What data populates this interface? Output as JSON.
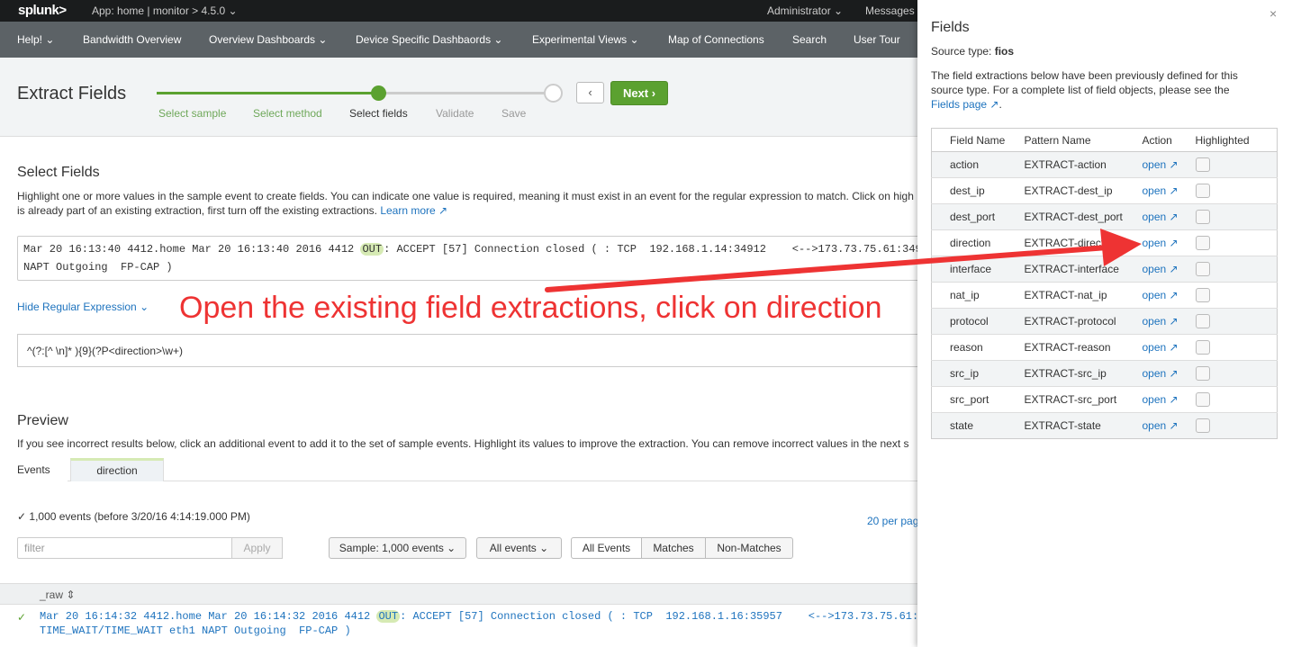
{
  "topbar": {
    "logo": "splunk>",
    "app": "App: home | monitor > 4.5.0 ⌄",
    "admin": "Administrator ⌄",
    "messages": "Messages"
  },
  "nav": {
    "items": [
      "Help! ⌄",
      "Bandwidth Overview",
      "Overview Dashboards ⌄",
      "Device Specific Dashbaords ⌄",
      "Experimental Views ⌄",
      "Map of Connections",
      "Search",
      "User Tour"
    ]
  },
  "header": {
    "title": "Extract Fields",
    "steps": [
      "Select sample",
      "Select method",
      "Select fields",
      "Validate",
      "Save"
    ],
    "back_label": "‹",
    "next_label": "Next ›"
  },
  "select_fields": {
    "title": "Select Fields",
    "desc_line1": "Highlight one or more values in the sample event to create fields. You can indicate one value is required, meaning it must exist in an event for the regular expression to match. Click on high",
    "desc_line2": "is already part of an existing extraction, first turn off the existing extractions.",
    "learn_more": "Learn more ↗",
    "sample_pre": "Mar 20 16:13:40 4412.home Mar 20 16:13:40 2016 4412 ",
    "sample_hl": "OUT",
    "sample_post": ": ACCEPT [57] Connection closed ( : TCP  192.168.1.14:34912    <-->173.73.75.61:349",
    "sample_line2": "NAPT Outgoing  FP-CAP )",
    "hide_regex": "Hide Regular Expression ⌄",
    "regex": "^(?:[^ \\n]* ){9}(?P<direction>\\w+)"
  },
  "annotation": "Open the existing field extractions, click on direction",
  "preview": {
    "title": "Preview",
    "desc": "If you see incorrect results below, click an additional event to add it to the set of sample events. Highlight its values to improve the extraction. You can remove incorrect values in the next s",
    "tabs": [
      "Events",
      "direction"
    ],
    "count": "✓ 1,000 events (before 3/20/16 4:14:19.000 PM)",
    "per_page": "20 per pag",
    "filter_placeholder": "filter",
    "apply": "Apply",
    "sample_btn": "Sample: 1,000 events ⌄",
    "all_events_btn": "All events ⌄",
    "seg": [
      "All Events",
      "Matches",
      "Non-Matches"
    ],
    "raw_header": "_raw ⇕",
    "raw_check": "✓",
    "raw_pre": "Mar 20 16:14:32 4412.home Mar 20 16:14:32 2016 4412 ",
    "raw_hl": "OUT",
    "raw_post": ": ACCEPT [57] Connection closed ( : TCP  192.168.1.16:35957    <-->173.73.75.61:",
    "raw_line2": "TIME_WAIT/TIME_WAIT eth1 NAPT Outgoing  FP-CAP )"
  },
  "panel": {
    "title": "Fields",
    "close": "×",
    "source_label": "Source type: ",
    "source_value": "fios",
    "desc": "The field extractions below have been previously defined for this source type. For a complete list of field objects, please see the",
    "fields_page": "Fields page ↗",
    "desc_end": ".",
    "columns": [
      "Field Name",
      "Pattern Name",
      "Action",
      "Highlighted"
    ],
    "rows": [
      {
        "field": "action",
        "pattern": "EXTRACT-action",
        "action": "open ↗"
      },
      {
        "field": "dest_ip",
        "pattern": "EXTRACT-dest_ip",
        "action": "open ↗"
      },
      {
        "field": "dest_port",
        "pattern": "EXTRACT-dest_port",
        "action": "open ↗"
      },
      {
        "field": "direction",
        "pattern": "EXTRACT-direction",
        "action": "open ↗"
      },
      {
        "field": "interface",
        "pattern": "EXTRACT-interface",
        "action": "open ↗"
      },
      {
        "field": "nat_ip",
        "pattern": "EXTRACT-nat_ip",
        "action": "open ↗"
      },
      {
        "field": "protocol",
        "pattern": "EXTRACT-protocol",
        "action": "open ↗"
      },
      {
        "field": "reason",
        "pattern": "EXTRACT-reason",
        "action": "open ↗"
      },
      {
        "field": "src_ip",
        "pattern": "EXTRACT-src_ip",
        "action": "open ↗"
      },
      {
        "field": "src_port",
        "pattern": "EXTRACT-src_port",
        "action": "open ↗"
      },
      {
        "field": "state",
        "pattern": "EXTRACT-state",
        "action": "open ↗"
      }
    ]
  },
  "colors": {
    "accent_green": "#5ba130",
    "link_blue": "#1e73be",
    "annotation_red": "#ee3333",
    "highlight_green": "#d6eab4"
  }
}
